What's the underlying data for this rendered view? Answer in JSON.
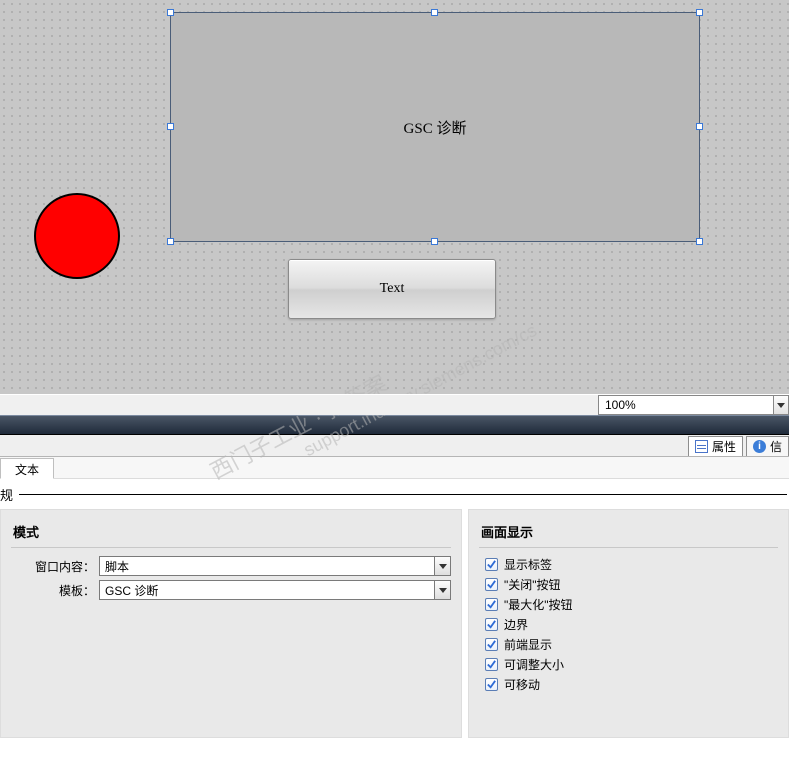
{
  "canvas": {
    "box_label": "GSC 诊断",
    "button_label": "Text",
    "zoom": "100%"
  },
  "tabs": {
    "properties": "属性",
    "info": "信"
  },
  "subtabs": {
    "text": "文本"
  },
  "section_label": "规",
  "mode": {
    "title": "模式",
    "window_content_label": "窗口内容：",
    "window_content_value": "脚本",
    "template_label": "模板：",
    "template_value": "GSC 诊断"
  },
  "display": {
    "title": "画面显示",
    "items": [
      {
        "label": "显示标签",
        "checked": true
      },
      {
        "label": "\"关闭\"按钮",
        "checked": true
      },
      {
        "label": "\"最大化\"按钮",
        "checked": true
      },
      {
        "label": "边界",
        "checked": true
      },
      {
        "label": "前端显示",
        "checked": true
      },
      {
        "label": "可调整大小",
        "checked": true
      },
      {
        "label": "可移动",
        "checked": true
      }
    ]
  },
  "watermarks": {
    "a": "西门子工业 · 找答案",
    "b": "support.industry.siemens.com/cs"
  }
}
